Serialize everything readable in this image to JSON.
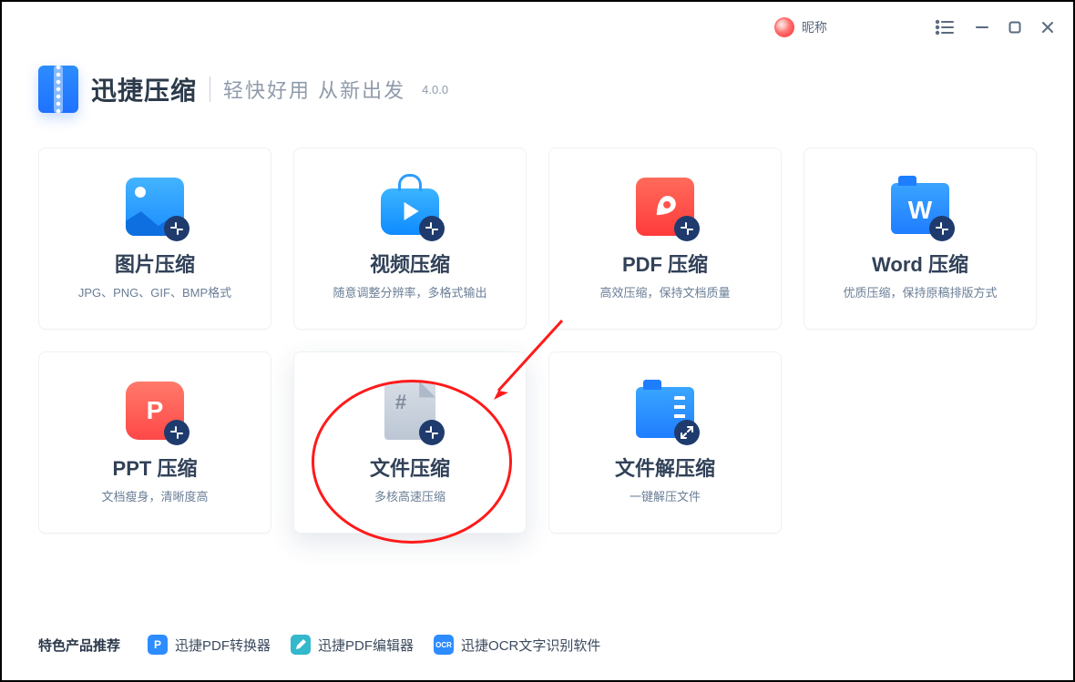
{
  "header": {
    "nickname": "昵称",
    "brand": "迅捷压缩",
    "tagline": "轻快好用 从新出发",
    "version": "4.0.0"
  },
  "cards": [
    {
      "title": "图片压缩",
      "sub": "JPG、PNG、GIF、BMP格式"
    },
    {
      "title": "视频压缩",
      "sub": "随意调整分辨率，多格式输出"
    },
    {
      "title": "PDF 压缩",
      "sub": "高效压缩，保持文档质量"
    },
    {
      "title": "Word 压缩",
      "sub": "优质压缩，保持原稿排版方式"
    },
    {
      "title": "PPT 压缩",
      "sub": "文档瘦身，清晰度高"
    },
    {
      "title": "文件压缩",
      "sub": "多核高速压缩"
    },
    {
      "title": "文件解压缩",
      "sub": "一键解压文件"
    }
  ],
  "footer": {
    "label": "特色产品推荐",
    "items": [
      {
        "name": "迅捷PDF转换器"
      },
      {
        "name": "迅捷PDF编辑器"
      },
      {
        "name": "迅捷OCR文字识别软件"
      }
    ],
    "icons": [
      "P",
      "",
      "OCR"
    ]
  },
  "window_controls": {
    "list": "list-icon",
    "minimize": "minimize-icon",
    "maximize": "maximize-icon",
    "close": "close-icon"
  }
}
